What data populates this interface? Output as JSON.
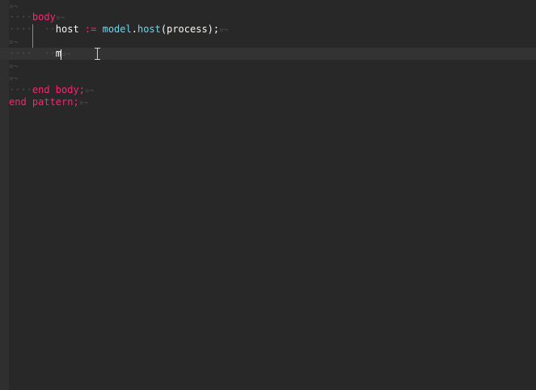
{
  "editor": {
    "eol_marker": "¤¬",
    "lines": [
      {
        "whitespace": "",
        "tokens": []
      },
      {
        "whitespace": "····",
        "tokens": [
          {
            "cls": "kw",
            "text": "body"
          }
        ]
      },
      {
        "whitespace": "····  ··",
        "tokens": [
          {
            "cls": "plain",
            "text": "host "
          },
          {
            "cls": "op",
            "text": ":="
          },
          {
            "cls": "plain",
            "text": " "
          },
          {
            "cls": "fn",
            "text": "model"
          },
          {
            "cls": "plain",
            "text": "."
          },
          {
            "cls": "fn",
            "text": "host"
          },
          {
            "cls": "plain",
            "text": "(process);"
          }
        ]
      },
      {
        "whitespace": "",
        "tokens": []
      },
      {
        "whitespace": "····  ··",
        "tokens": [
          {
            "cls": "plain",
            "text": "m"
          }
        ]
      },
      {
        "whitespace": "",
        "tokens": []
      },
      {
        "whitespace": "",
        "tokens": []
      },
      {
        "whitespace": "····",
        "tokens": [
          {
            "cls": "kw",
            "text": "end body;"
          }
        ]
      },
      {
        "whitespace": "",
        "tokens": [
          {
            "cls": "kw",
            "text": "end pattern;"
          }
        ]
      }
    ],
    "current_line": 4
  },
  "colors": {
    "background": "#282828",
    "keyword": "#f92672",
    "function": "#66d9ef",
    "text": "#f8f8f2",
    "whitespace": "#505050"
  }
}
